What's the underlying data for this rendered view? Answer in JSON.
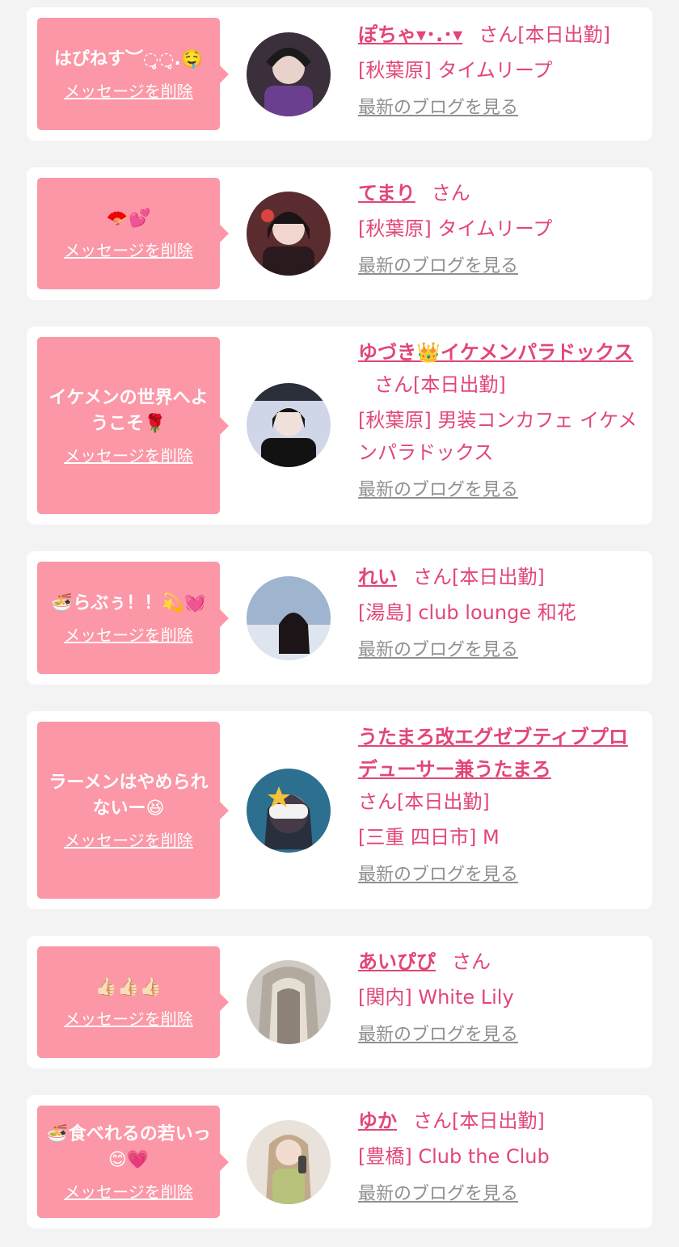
{
  "cards": [
    {
      "message": "はぴねす︶◌̥̥◌̥.🤤",
      "delete_label": "メッセージを削除",
      "name": "ぽちゃ▾･.･▾",
      "suffix": "さん[本日出勤]",
      "shop": "[秋葉原] タイムリープ",
      "blog_label": "最新のブログを見る",
      "avatar_color": "#3a2f3a"
    },
    {
      "message": "🪭💕",
      "delete_label": "メッセージを削除",
      "name": "てまり",
      "suffix": "さん",
      "shop": "[秋葉原] タイムリープ",
      "blog_label": "最新のブログを見る",
      "avatar_color": "#5b2c2f"
    },
    {
      "message": "イケメンの世界へようこそ🌹",
      "delete_label": "メッセージを削除",
      "name": "ゆづき👑イケメンパラドックス",
      "suffix": "さん[本日出勤]",
      "shop": "[秋葉原] 男装コンカフェ イケメンパラドックス",
      "blog_label": "最新のブログを見る",
      "avatar_color": "#2a2f3a"
    },
    {
      "message": "🍜らぶぅ！！💫💓",
      "delete_label": "メッセージを削除",
      "name": "れい",
      "suffix": "さん[本日出勤]",
      "shop": "[湯島] club lounge 和花",
      "blog_label": "最新のブログを見る",
      "avatar_color": "#9fb4cf"
    },
    {
      "message": "ラーメンはやめられないー😆",
      "delete_label": "メッセージを削除",
      "name": "うたまろ改エグゼブティブプロデューサー兼うたまろ",
      "suffix": "さん[本日出勤]",
      "shop": "[三重 四日市] M",
      "blog_label": "最新のブログを見る",
      "avatar_color": "#2d6f8f"
    },
    {
      "message": "👍🏻👍🏻👍🏻",
      "delete_label": "メッセージを削除",
      "name": "あいぴぴ",
      "suffix": "さん",
      "shop": "[関内] White Lily",
      "blog_label": "最新のブログを見る",
      "avatar_color": "#b9b0a6"
    },
    {
      "message": "🍜食べれるの若いっ😊💗",
      "delete_label": "メッセージを削除",
      "name": "ゆか",
      "suffix": "さん[本日出勤]",
      "shop": "[豊橋] Club the Club",
      "blog_label": "最新のブログを見る",
      "avatar_color": "#c2a98c"
    }
  ]
}
